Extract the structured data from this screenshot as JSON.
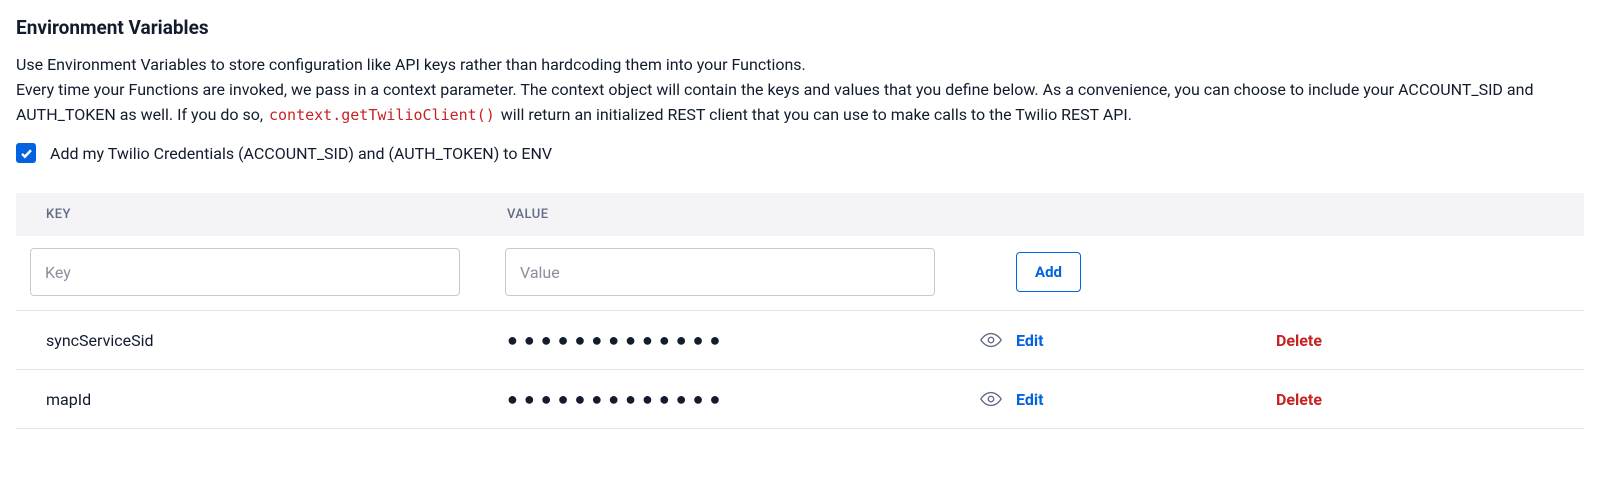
{
  "heading": "Environment Variables",
  "description": {
    "p1": "Use Environment Variables to store configuration like API keys rather than hardcoding them into your Functions.",
    "p2a": "Every time your Functions are invoked, we pass in a context parameter. The context object will contain the keys and values that you define below. As a convenience, you can choose to include your ACCOUNT_SID and AUTH_TOKEN as well. If you do so, ",
    "code": "context.getTwilioClient()",
    "p2b": " will return an initialized REST client that you can use to make calls to the Twilio REST API."
  },
  "checkbox": {
    "checked": true,
    "label": "Add my Twilio Credentials (ACCOUNT_SID) and (AUTH_TOKEN) to ENV"
  },
  "table": {
    "headers": {
      "key": "KEY",
      "value": "VALUE"
    },
    "input": {
      "key_placeholder": "Key",
      "value_placeholder": "Value",
      "add_label": "Add"
    },
    "rows": [
      {
        "key": "syncServiceSid",
        "value_masked": "●●●●●●●●●●●●●",
        "edit": "Edit",
        "delete": "Delete"
      },
      {
        "key": "mapId",
        "value_masked": "●●●●●●●●●●●●●",
        "edit": "Edit",
        "delete": "Delete"
      }
    ]
  }
}
